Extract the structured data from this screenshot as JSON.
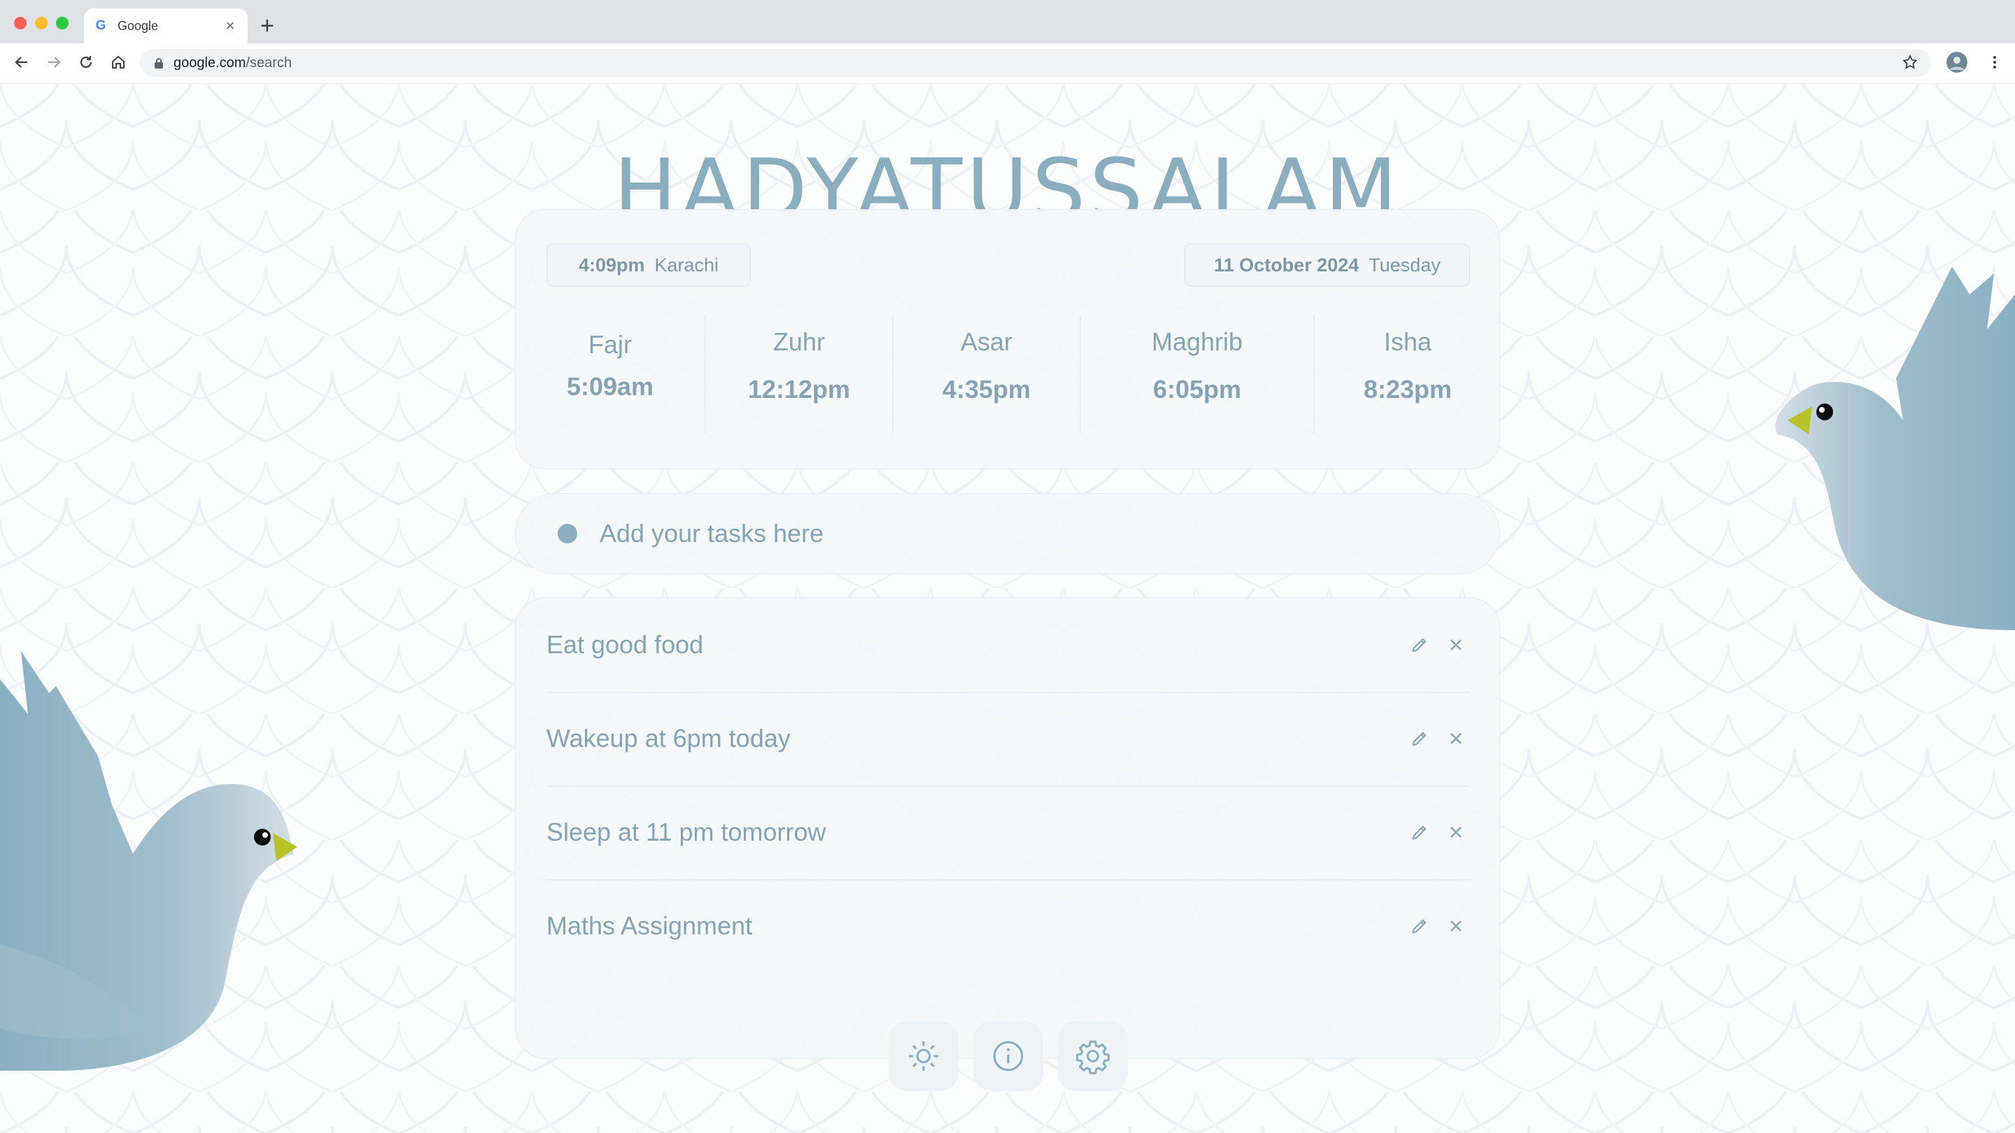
{
  "browser": {
    "tab_title": "Google",
    "favicon_letter": "G",
    "url_host": "google.com",
    "url_path": "/search"
  },
  "app": {
    "title": "HADYATUSSALAM",
    "accent": "#8aaec0"
  },
  "clock": {
    "time": "4:09pm",
    "city": "Karachi",
    "date": "11 October 2024",
    "weekday": "Tuesday"
  },
  "prayers": [
    {
      "name": "Fajr",
      "time": "5:09am"
    },
    {
      "name": "Zuhr",
      "time": "12:12pm"
    },
    {
      "name": "Asar",
      "time": "4:35pm"
    },
    {
      "name": "Maghrib",
      "time": "6:05pm"
    },
    {
      "name": "Isha",
      "time": "8:23pm"
    }
  ],
  "task_input": {
    "placeholder": "Add your tasks here"
  },
  "tasks": [
    {
      "text": "Eat good food",
      "edit_icon": "pencil-icon",
      "delete_icon": "close-icon"
    },
    {
      "text": "Wakeup at 6pm today",
      "edit_icon": "pencil-icon",
      "delete_icon": "close-icon"
    },
    {
      "text": "Sleep at 11 pm tomorrow",
      "edit_icon": "pencil-icon",
      "delete_icon": "close-icon"
    },
    {
      "text": "Maths Assignment",
      "edit_icon": "pencil-icon",
      "delete_icon": "close-icon"
    }
  ],
  "footer_buttons": [
    {
      "icon": "sun-icon"
    },
    {
      "icon": "info-icon"
    },
    {
      "icon": "gear-icon"
    }
  ]
}
